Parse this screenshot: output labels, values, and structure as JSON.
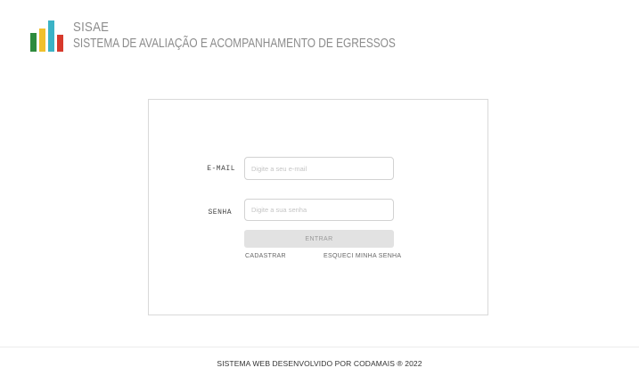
{
  "header": {
    "logo": {
      "icon": "bar-chart-logo",
      "bar_colors": [
        "#2e8b3e",
        "#f0c02c",
        "#3bb3c6",
        "#d7392b"
      ]
    },
    "title": "SISAE",
    "subtitle": "SISTEMA DE AVALIAÇÃO E ACOMPANHAMENTO DE EGRESSOS"
  },
  "login": {
    "email_label": "E-MAIL",
    "email_placeholder": "Digite a seu e-mail",
    "email_value": "",
    "password_label": "SENHA",
    "password_placeholder": "Digite a sua senha",
    "password_value": "",
    "submit_label": "ENTRAR",
    "register_link": "CADASTRAR",
    "forgot_link": "ESQUECI MINHA SENHA"
  },
  "footer": {
    "text": "SISTEMA WEB DESENVOLVIDO POR CODAMAIS ® 2022"
  },
  "colors": {
    "button_bg": "#e2e2e2",
    "border": "#d9d9d9",
    "brand_text": "#8c8c8c"
  }
}
